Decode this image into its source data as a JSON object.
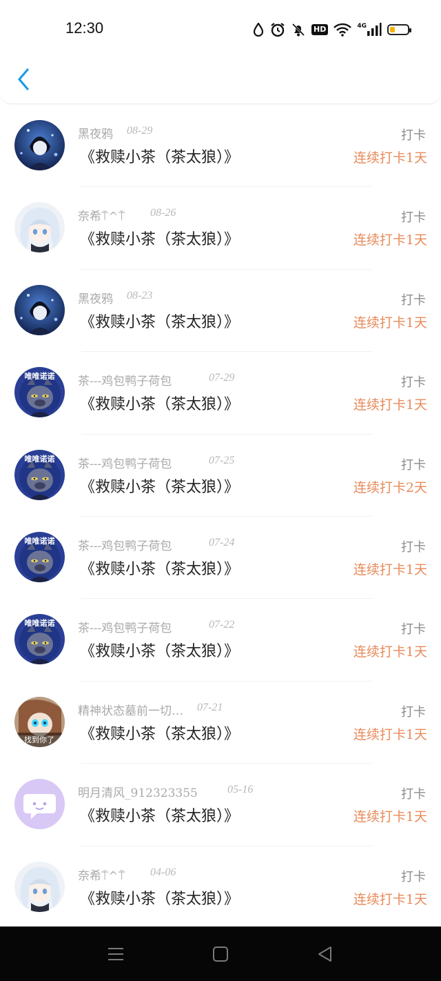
{
  "status_bar": {
    "time": "12:30",
    "hd_label": "HD",
    "network_label": "4G",
    "battery_percent": 30,
    "battery_color": "#f4b400"
  },
  "header": {
    "back_icon": "chevron-left-icon",
    "accent": "#1e9be8"
  },
  "colors": {
    "name": "#a9a9a9",
    "title": "#262626",
    "streak": "#e88a5a",
    "tag": "#8c8c8c"
  },
  "records": [
    {
      "name": "黑夜鸦",
      "date": "08-29",
      "title": "《救赎小茶（茶太狼）》",
      "tag": "打卡",
      "streak": "连续打卡1天",
      "avatar": "dark-anime-boy"
    },
    {
      "name": "奈希⍑^⍑",
      "date": "08-26",
      "title": "《救赎小茶（茶太狼）》",
      "tag": "打卡",
      "streak": "连续打卡1天",
      "avatar": "white-hair-girl"
    },
    {
      "name": "黑夜鸦",
      "date": "08-23",
      "title": "《救赎小茶（茶太狼）》",
      "tag": "打卡",
      "streak": "连续打卡1天",
      "avatar": "dark-anime-boy"
    },
    {
      "name": "茶---鸡包鸭子荷包",
      "date": "07-29",
      "title": "《救赎小茶（茶太狼）》",
      "tag": "打卡",
      "streak": "连续打卡1天",
      "avatar": "wolf-cartoon"
    },
    {
      "name": "茶---鸡包鸭子荷包",
      "date": "07-25",
      "title": "《救赎小茶（茶太狼）》",
      "tag": "打卡",
      "streak": "连续打卡2天",
      "avatar": "wolf-cartoon"
    },
    {
      "name": "茶---鸡包鸭子荷包",
      "date": "07-24",
      "title": "《救赎小茶（茶太狼）》",
      "tag": "打卡",
      "streak": "连续打卡1天",
      "avatar": "wolf-cartoon"
    },
    {
      "name": "茶---鸡包鸭子荷包",
      "date": "07-22",
      "title": "《救赎小茶（茶太狼）》",
      "tag": "打卡",
      "streak": "连续打卡1天",
      "avatar": "wolf-cartoon"
    },
    {
      "name": "精神状态墓前一切…",
      "date": "07-21",
      "title": "《救赎小茶（茶太狼）》",
      "tag": "打卡",
      "streak": "连续打卡1天",
      "avatar": "meme-girl"
    },
    {
      "name": "明月清风_912323355",
      "date": "05-16",
      "title": "《救赎小茶（茶太狼）》",
      "tag": "打卡",
      "streak": "连续打卡1天",
      "avatar": "default-chat-bubble"
    },
    {
      "name": "奈希⍑^⍑",
      "date": "04-06",
      "title": "《救赎小茶（茶太狼）》",
      "tag": "打卡",
      "streak": "连续打卡1天",
      "avatar": "white-hair-girl"
    }
  ],
  "avatar_texts": {
    "wolf_caption": "唯唯诺诺",
    "meme_caption": "找到你了"
  },
  "nav": {
    "menu_icon": "menu-icon",
    "home_icon": "square-home-icon",
    "back_icon": "triangle-back-icon"
  }
}
